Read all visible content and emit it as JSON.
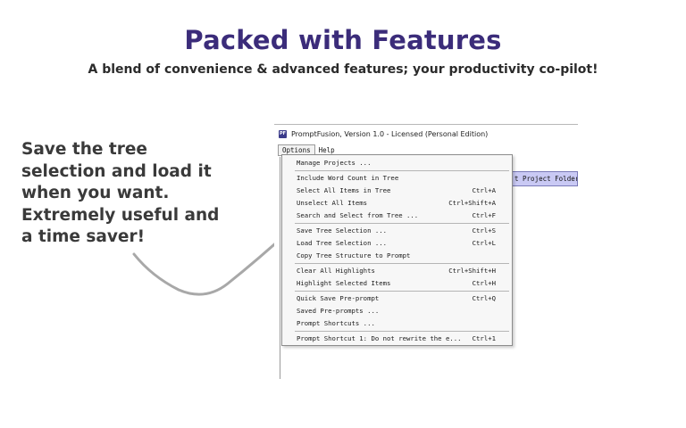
{
  "header": {
    "title": "Packed with Features",
    "subtitle": "A blend of convenience & advanced features; your productivity co-pilot!"
  },
  "callout": {
    "lines": [
      "Save the tree",
      "selection and load it",
      "when you want.",
      "Extremely useful and",
      "a time saver!"
    ]
  },
  "app": {
    "icon_text": "PF",
    "window_title": "PromptFusion, Version 1.0 - Licensed (Personal Edition)",
    "menubar": [
      {
        "label": "Options"
      },
      {
        "label": "Help"
      }
    ],
    "background_field": "t Project Folder",
    "colors": {
      "title": "#3b2c7a",
      "selection": "#c9c9f4"
    }
  },
  "menu": {
    "items": [
      {
        "label": "Manage Projects ...",
        "shortcut": ""
      },
      {
        "label": "Include Word Count in Tree",
        "shortcut": ""
      },
      {
        "label": "Select All Items in Tree",
        "shortcut": "Ctrl+A"
      },
      {
        "label": "Unselect All Items",
        "shortcut": "Ctrl+Shift+A"
      },
      {
        "label": "Search and Select from Tree ...",
        "shortcut": "Ctrl+F"
      },
      {
        "label": "Save Tree Selection ...",
        "shortcut": "Ctrl+S"
      },
      {
        "label": "Load Tree Selection ...",
        "shortcut": "Ctrl+L"
      },
      {
        "label": "Copy Tree Structure to Prompt",
        "shortcut": ""
      },
      {
        "label": "Clear All Highlights",
        "shortcut": "Ctrl+Shift+H"
      },
      {
        "label": "Highlight Selected Items",
        "shortcut": "Ctrl+H"
      },
      {
        "label": "Quick Save Pre-prompt",
        "shortcut": "Ctrl+Q"
      },
      {
        "label": "Saved Pre-prompts ...",
        "shortcut": ""
      },
      {
        "label": "Prompt Shortcuts ...",
        "shortcut": ""
      },
      {
        "label": "Prompt Shortcut 1: Do not rewrite the e...",
        "shortcut": "Ctrl+1"
      }
    ]
  }
}
